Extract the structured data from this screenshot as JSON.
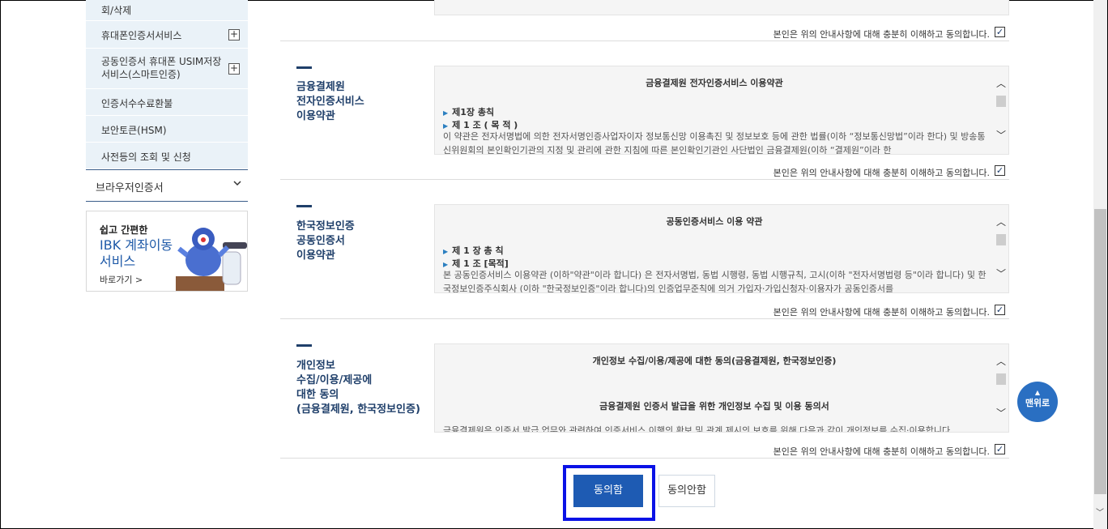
{
  "sidebar": {
    "items": [
      {
        "label": "회/삭제",
        "has_plus": false
      },
      {
        "label": "휴대폰인증서서비스",
        "has_plus": true
      },
      {
        "label": "공동인증서 휴대폰 USIM저장서비스(스마트인증)",
        "has_plus": true
      },
      {
        "label": "인증서수수료환불",
        "has_plus": false
      },
      {
        "label": "보안토큰(HSM)",
        "has_plus": false
      },
      {
        "label": "사전등의 조회 및 신청",
        "has_plus": false
      }
    ],
    "plus_symbol": "+",
    "browser_cert": "브라우저인증서",
    "banner": {
      "line1": "쉽고 간편한",
      "line2": "IBK 계좌이동",
      "line3": "서비스",
      "link": "바로가기 >"
    }
  },
  "agree_text": "본인은 위의 안내사항에 대해 충분히 이해하고 동의합니다.",
  "check_mark": "✓",
  "sections": [
    {
      "title": [
        "금융결제원",
        "전자인증서비스",
        "이용약관"
      ],
      "head": "금융결제원 전자인증서비스 이용약관",
      "chapter1": "제1장 총칙",
      "chapter2": "제 1 조 ( 목 적 )",
      "body": "이 약관은 전자서명법에 의한 전자서명인증사업자이자 정보통신망 이용촉진 및 정보보호 등에 관한 법률(이하 “정보통신망법”이라 한다) 및 방송통신위원회의 본인확인기관의 지정 및 관리에 관한 지침에 따른 본인확인기관인 사단법인 금융결제원(이하 “결제원”이라 한"
    },
    {
      "title": [
        "한국정보인증",
        "공동인증서",
        "이용약관"
      ],
      "head": "공동인증서비스 이용 약관",
      "chapter1": "제 1 장 총 칙",
      "chapter2": "제 1 조 [목적]",
      "body": "본 공동인증서비스 이용약관 (이하\"약관\"이라 합니다) 은 전자서명법, 동법 시행령, 동법 시행규칙, 고시(이하 \"전자서명법령 등\"이라 합니다) 및 한국정보인증주식회사 (이하 \"한국정보인증\"이라 합니다)의 인증업무준칙에 의거 가입자·가입신청자·이용자가 공동인증서를"
    },
    {
      "title": [
        "개인정보",
        "수집/이용/제공에",
        "대한 동의",
        "(금융결제원, 한국정보인증)"
      ],
      "head": "개인정보 수집/이용/제공에 대한 동의(금융결제원, 한국정보인증)",
      "subhead": "금융결제원 인증서 발급을 위한 개인정보 수집 및 이용 동의서",
      "body": "금융결제원은 인증서 발급 업무와 관련하여 인증서비스 이행의 확보 및 관계 제시의 보호를 위해 다음과 같이 개인정보를 수집·이용합니다."
    }
  ],
  "buttons": {
    "agree": "동의함",
    "disagree": "동의안함",
    "to_top": "맨위로"
  },
  "colors": {
    "primary": "#1e5bb3",
    "navy": "#1f3f6a",
    "focus": "#0a12e6"
  }
}
